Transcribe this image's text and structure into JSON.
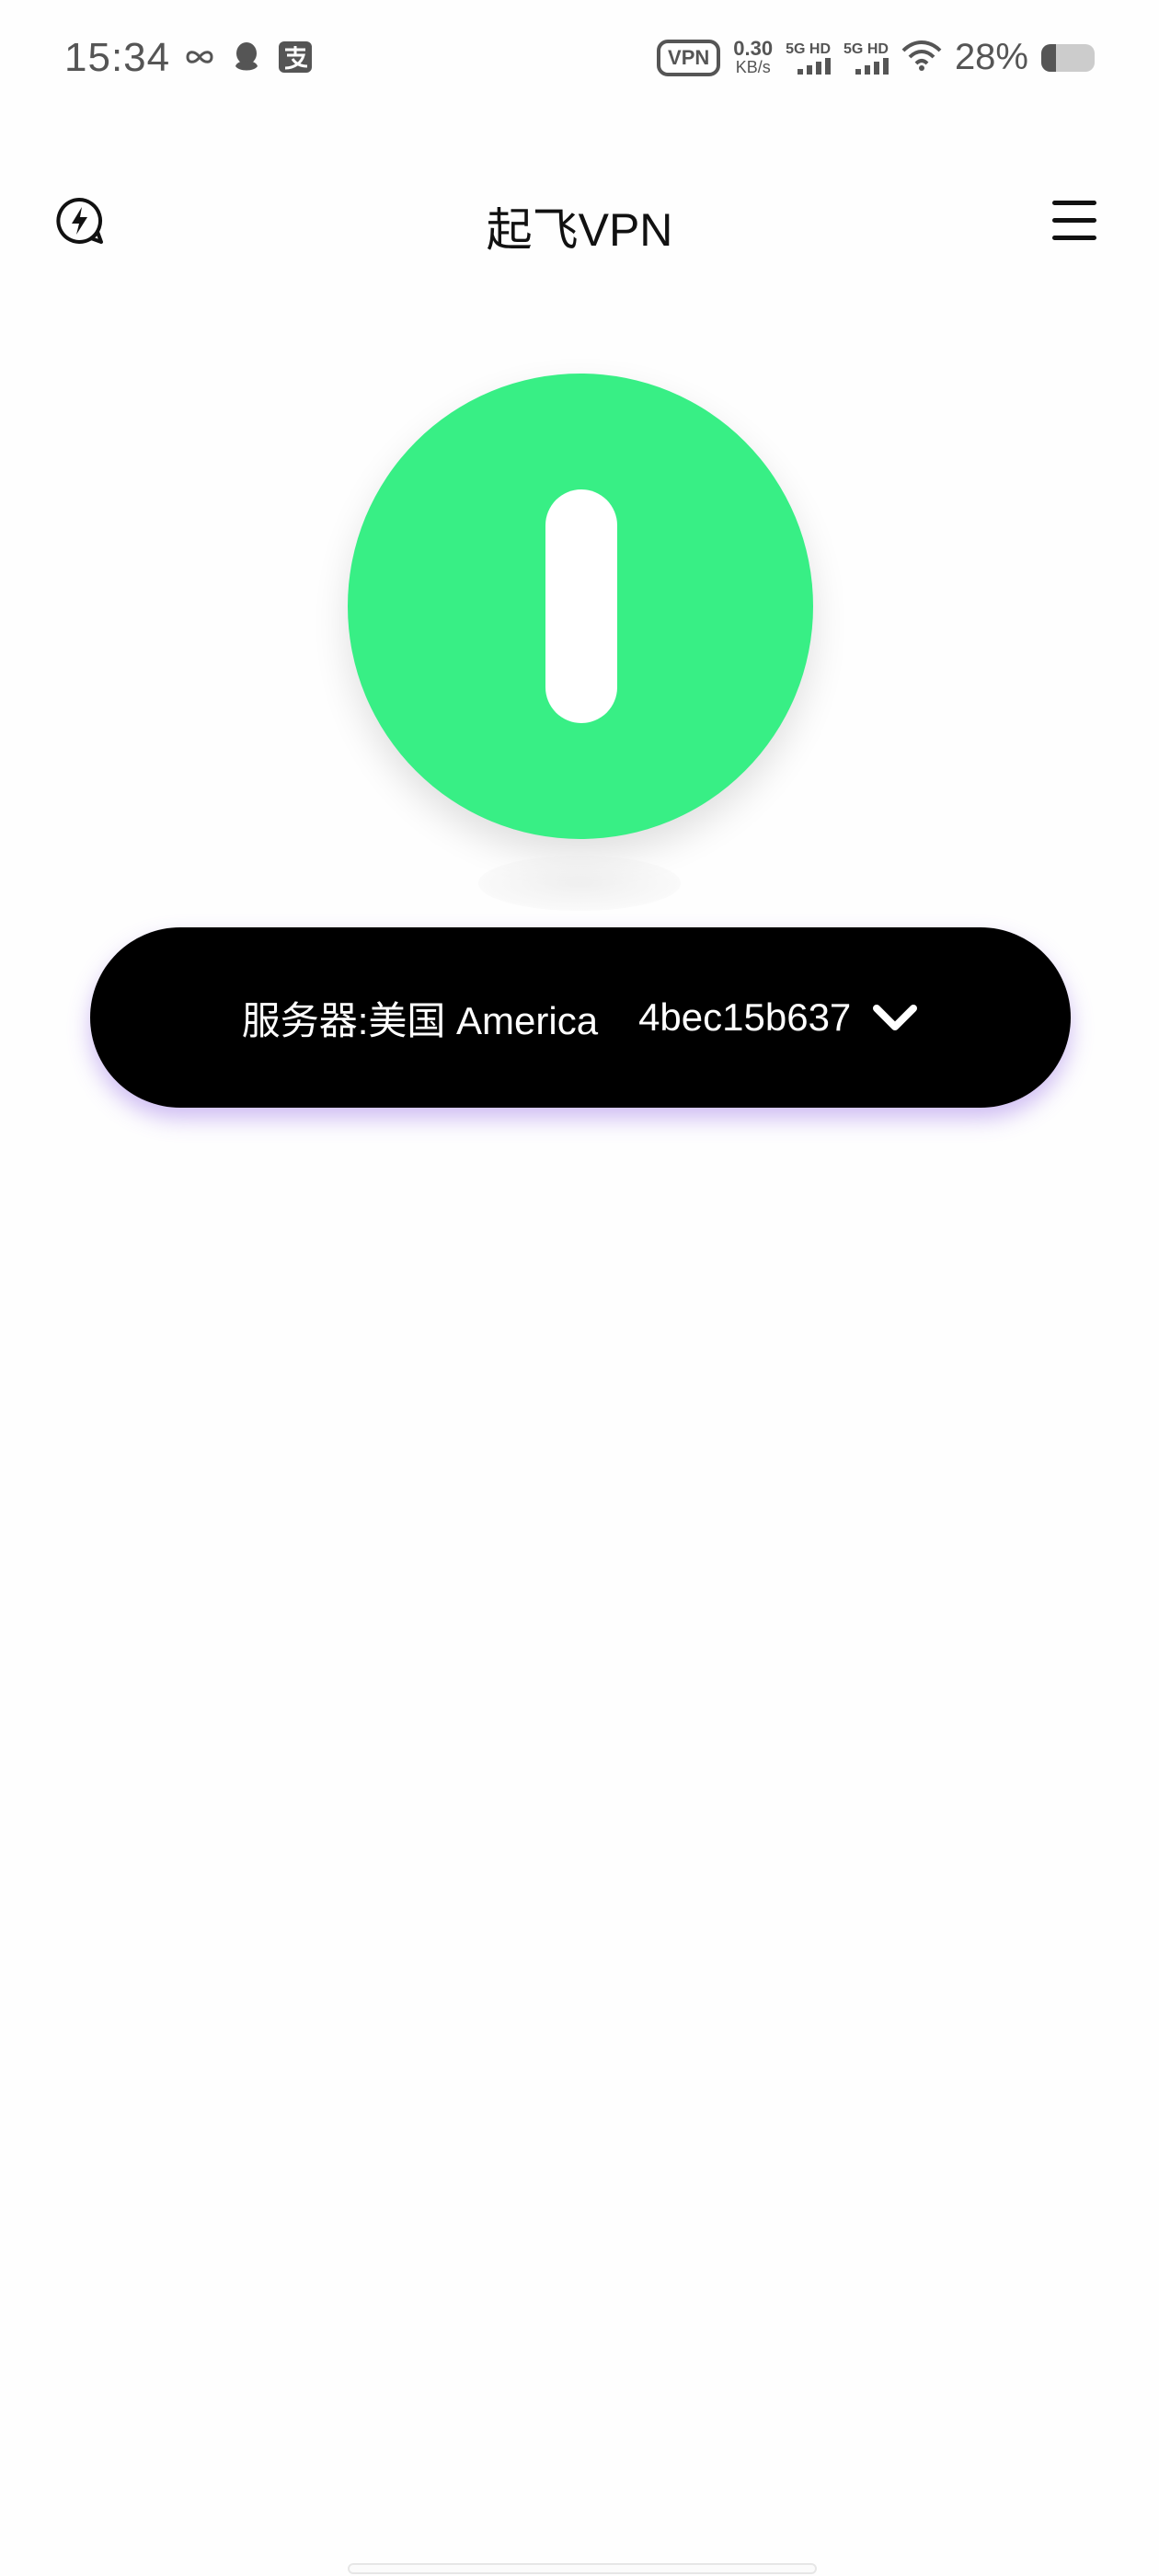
{
  "status_bar": {
    "time": "15:34",
    "vpn_badge": "VPN",
    "net_speed_value": "0.30",
    "net_speed_unit": "KB/s",
    "sim1_label": "5G HD",
    "sim2_label": "5G HD",
    "battery_percent": "28%",
    "battery_level": 0.28,
    "icons": [
      "link-icon",
      "qq-penguin-icon",
      "alipay-icon",
      "wifi-icon",
      "battery-icon"
    ]
  },
  "header": {
    "title": "起飞VPN",
    "left_icon": "lightning-bubble-icon",
    "right_icon": "menu-icon"
  },
  "power": {
    "color": "#38ef85",
    "icon": "power-icon"
  },
  "server": {
    "label": "服务器:美国 America",
    "id": "4bec15b637",
    "icon": "chevron-down-icon",
    "glow_color": "#966ee6"
  }
}
